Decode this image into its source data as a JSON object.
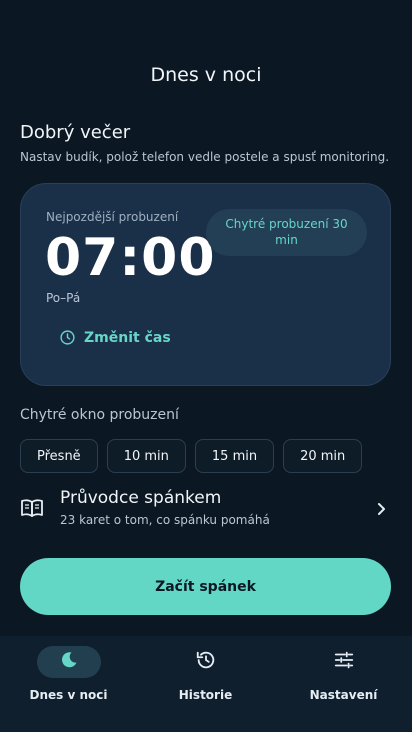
{
  "header": {
    "title": "Dnes v noci"
  },
  "greeting": {
    "title": "Dobrý večer",
    "subtitle": "Nastav budík, polož telefon vedle postele a spusť monitoring."
  },
  "alarm": {
    "label": "Nejpozdější probuzení",
    "time": "07:00",
    "days": "Po–Pá",
    "smart_chip": "Chytré probuzení 30 min",
    "change_label": "Změnit čas"
  },
  "smart_window": {
    "label": "Chytré okno probuzení",
    "options": [
      "Přesně",
      "10 min",
      "15 min",
      "20 min"
    ]
  },
  "guide": {
    "title": "Průvodce spánkem",
    "subtitle": "23 karet o tom, co spánku pomáhá"
  },
  "start_button": {
    "label": "Začít spánek"
  },
  "nav": {
    "items": [
      {
        "label": "Dnes v noci",
        "icon": "moon-icon",
        "active": true
      },
      {
        "label": "Historie",
        "icon": "history-icon",
        "active": false
      },
      {
        "label": "Nastavení",
        "icon": "sliders-icon",
        "active": false
      }
    ]
  },
  "colors": {
    "background": "#0b1823",
    "accent": "#63d7c6",
    "card": "#1a2f48"
  }
}
